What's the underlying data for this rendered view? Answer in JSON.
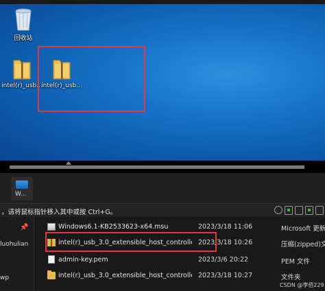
{
  "desktop": {
    "recycle_bin_label": "回收站",
    "icons": [
      {
        "label": "intel(r)_usb..."
      },
      {
        "label": "intel(r)_usb..."
      }
    ]
  },
  "taskbar": {
    "thumb_label": "W..."
  },
  "status": {
    "hint": "，请将鼠标指针移入其中或按 Ctrl+G。"
  },
  "nav": {
    "items": [
      {
        "label": "luohulian"
      },
      {
        "label": "wp"
      }
    ]
  },
  "files": [
    {
      "name": "Windows6.1-KB2533623-x64.msu",
      "date": "2023/3/18 11:06",
      "type": "Microsoft 更新",
      "icon": "msu-icon"
    },
    {
      "name": "intel(r)_usb_3.0_extensible_host_controller_...",
      "date": "2023/3/18 10:26",
      "type": "压缩(zipped)文",
      "icon": "zip-folder-icon"
    },
    {
      "name": "admin-key.pem",
      "date": "2023/3/6 20:22",
      "type": "PEM 文件",
      "icon": "file-icon"
    },
    {
      "name": "intel(r)_usb_3.0_extensible_host_controller_...",
      "date": "2023/3/18 10:27",
      "type": "文件夹",
      "icon": "folder-icon"
    }
  ],
  "watermark": "CSDN @李佰229",
  "colors": {
    "highlight": "#e0393e",
    "desktop_blue": "#1673c9"
  }
}
